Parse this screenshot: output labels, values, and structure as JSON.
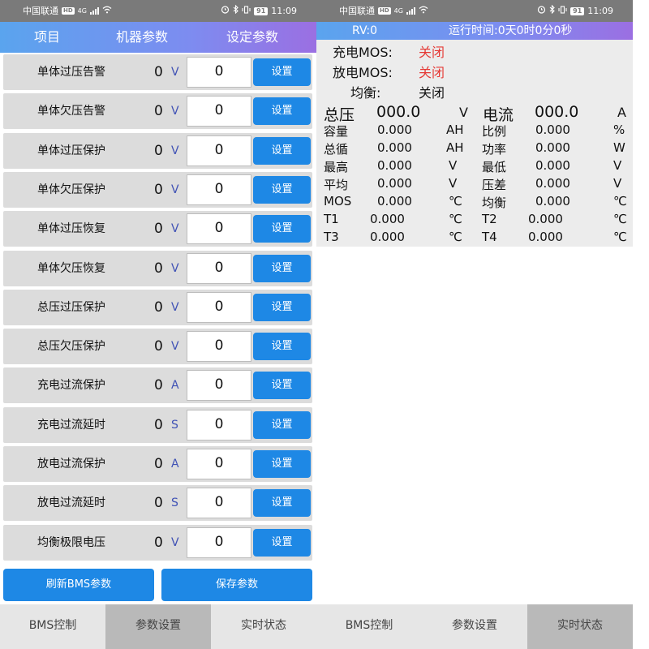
{
  "status_bar": {
    "carrier": "中国联通",
    "hd": "HD",
    "net": "4G",
    "battery": "91",
    "time": "11:09"
  },
  "params": {
    "header": {
      "col1": "项目",
      "col2": "机器参数",
      "col3": "设定参数"
    },
    "rows": [
      {
        "name": "单体过压告警",
        "value": "0",
        "unit": "V",
        "input": "0",
        "button": "设置"
      },
      {
        "name": "单体欠压告警",
        "value": "0",
        "unit": "V",
        "input": "0",
        "button": "设置"
      },
      {
        "name": "单体过压保护",
        "value": "0",
        "unit": "V",
        "input": "0",
        "button": "设置"
      },
      {
        "name": "单体欠压保护",
        "value": "0",
        "unit": "V",
        "input": "0",
        "button": "设置"
      },
      {
        "name": "单体过压恢复",
        "value": "0",
        "unit": "V",
        "input": "0",
        "button": "设置"
      },
      {
        "name": "单体欠压恢复",
        "value": "0",
        "unit": "V",
        "input": "0",
        "button": "设置"
      },
      {
        "name": "总压过压保护",
        "value": "0",
        "unit": "V",
        "input": "0",
        "button": "设置"
      },
      {
        "name": "总压欠压保护",
        "value": "0",
        "unit": "V",
        "input": "0",
        "button": "设置"
      },
      {
        "name": "充电过流保护",
        "value": "0",
        "unit": "A",
        "input": "0",
        "button": "设置"
      },
      {
        "name": "充电过流延时",
        "value": "0",
        "unit": "S",
        "input": "0",
        "button": "设置"
      },
      {
        "name": "放电过流保护",
        "value": "0",
        "unit": "A",
        "input": "0",
        "button": "设置"
      },
      {
        "name": "放电过流延时",
        "value": "0",
        "unit": "S",
        "input": "0",
        "button": "设置"
      },
      {
        "name": "均衡极限电压",
        "value": "0",
        "unit": "V",
        "input": "0",
        "button": "设置"
      }
    ],
    "refresh_button": "刷新BMS参数",
    "save_button": "保存参数"
  },
  "tabs": [
    {
      "label": "BMS控制"
    },
    {
      "label": "参数设置"
    },
    {
      "label": "实时状态"
    }
  ],
  "realtime": {
    "header": {
      "rv": "RV:0",
      "runtime": "运行时间:0天0时0分0秒"
    },
    "charge_mos": {
      "label": "充电MOS:",
      "value": "关闭"
    },
    "discharge_mos": {
      "label": "放电MOS:",
      "value": "关闭"
    },
    "balance": {
      "label": "均衡:",
      "value": "关闭"
    },
    "total_voltage": {
      "label": "总压",
      "value": "000.0",
      "unit": "V"
    },
    "current": {
      "label": "电流",
      "value": "000.0",
      "unit": "A"
    },
    "rows": [
      {
        "l_label": "容量",
        "l_value": "0.000",
        "l_unit": "AH",
        "r_label": "比例",
        "r_value": "0.000",
        "r_unit": "%"
      },
      {
        "l_label": "总循",
        "l_value": "0.000",
        "l_unit": "AH",
        "r_label": "功率",
        "r_value": "0.000",
        "r_unit": "W"
      },
      {
        "l_label": "最高",
        "l_value": "0.000",
        "l_unit": "V",
        "r_label": "最低",
        "r_value": "0.000",
        "r_unit": "V"
      },
      {
        "l_label": "平均",
        "l_value": "0.000",
        "l_unit": "V",
        "r_label": "压差",
        "r_value": "0.000",
        "r_unit": "V"
      },
      {
        "l_label": "MOS",
        "l_value": "0.000",
        "l_unit": "℃",
        "r_label": "均衡",
        "r_value": "0.000",
        "r_unit": "℃"
      },
      {
        "l_label": "T1",
        "l_value": "0.000",
        "l_unit": "℃",
        "r_label": "T2",
        "r_value": "0.000",
        "r_unit": "℃"
      },
      {
        "l_label": "T3",
        "l_value": "0.000",
        "l_unit": "℃",
        "r_label": "T4",
        "r_value": "0.000",
        "r_unit": "℃"
      }
    ]
  }
}
